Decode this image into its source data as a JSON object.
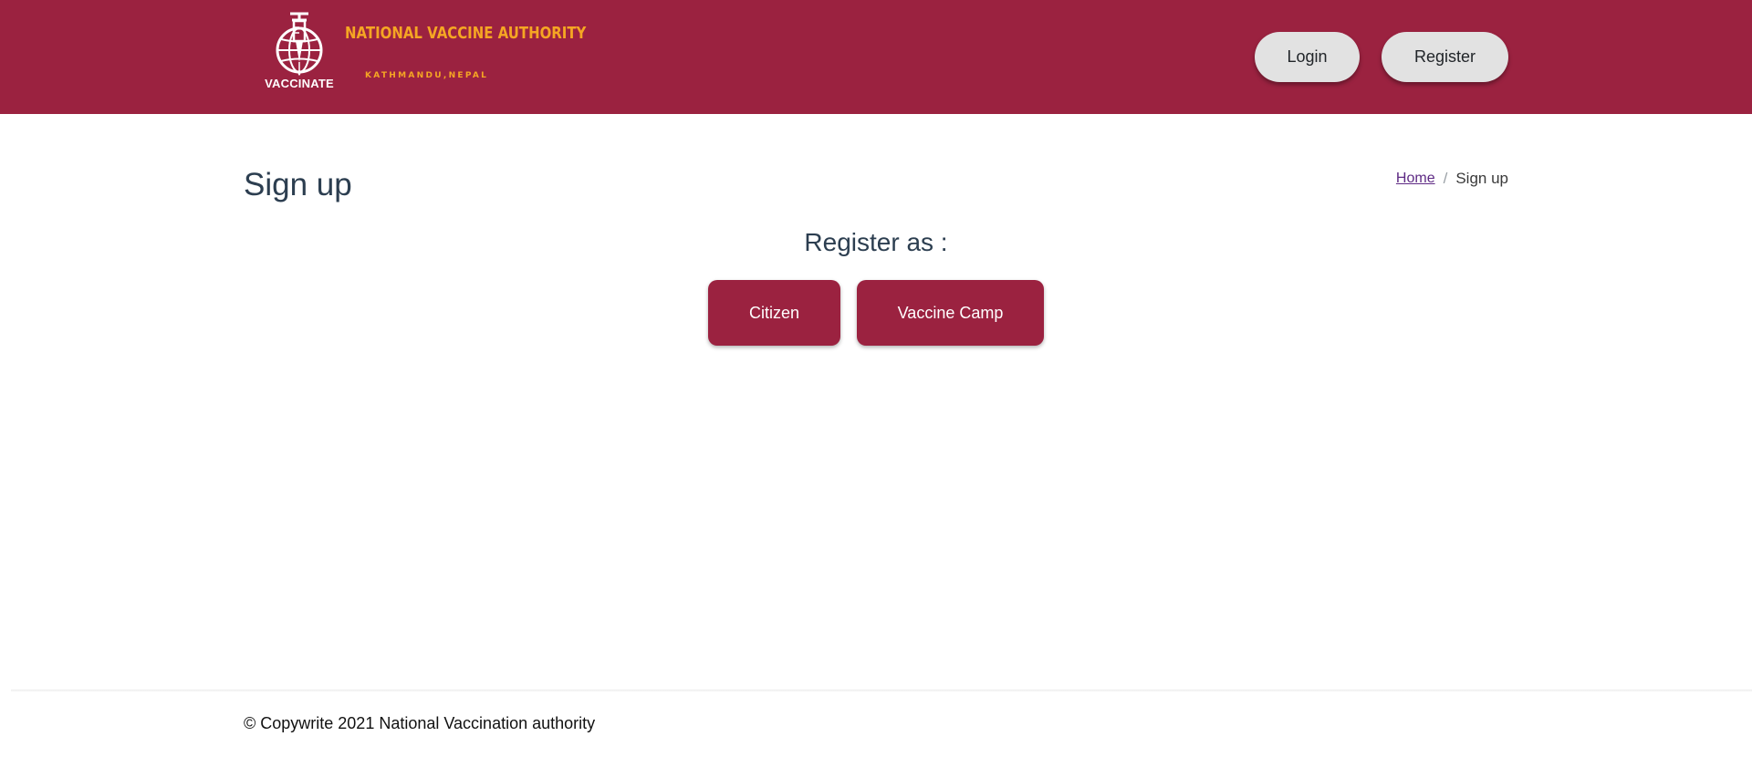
{
  "header": {
    "logo_word": "VACCINATE",
    "brand_title": "NATIONAL VACCINE AUTHORITY",
    "brand_subtitle": "KATHMANDU,NEPAL",
    "nav": {
      "login_label": "Login",
      "register_label": "Register"
    }
  },
  "main": {
    "page_title": "Sign up",
    "breadcrumb": {
      "home": "Home",
      "separator": "/",
      "current": "Sign up"
    },
    "register_as": "Register as :",
    "options": {
      "citizen_label": "Citizen",
      "vaccine_camp_label": "Vaccine Camp"
    }
  },
  "footer": {
    "copyright": "© Copywrite 2021 National Vaccination authority"
  },
  "colors": {
    "brand": "#9b2240",
    "accent": "#f5a623",
    "pill": "#e2e2e2"
  },
  "icons": {
    "logo": "vaccine-globe-syringe-icon"
  }
}
